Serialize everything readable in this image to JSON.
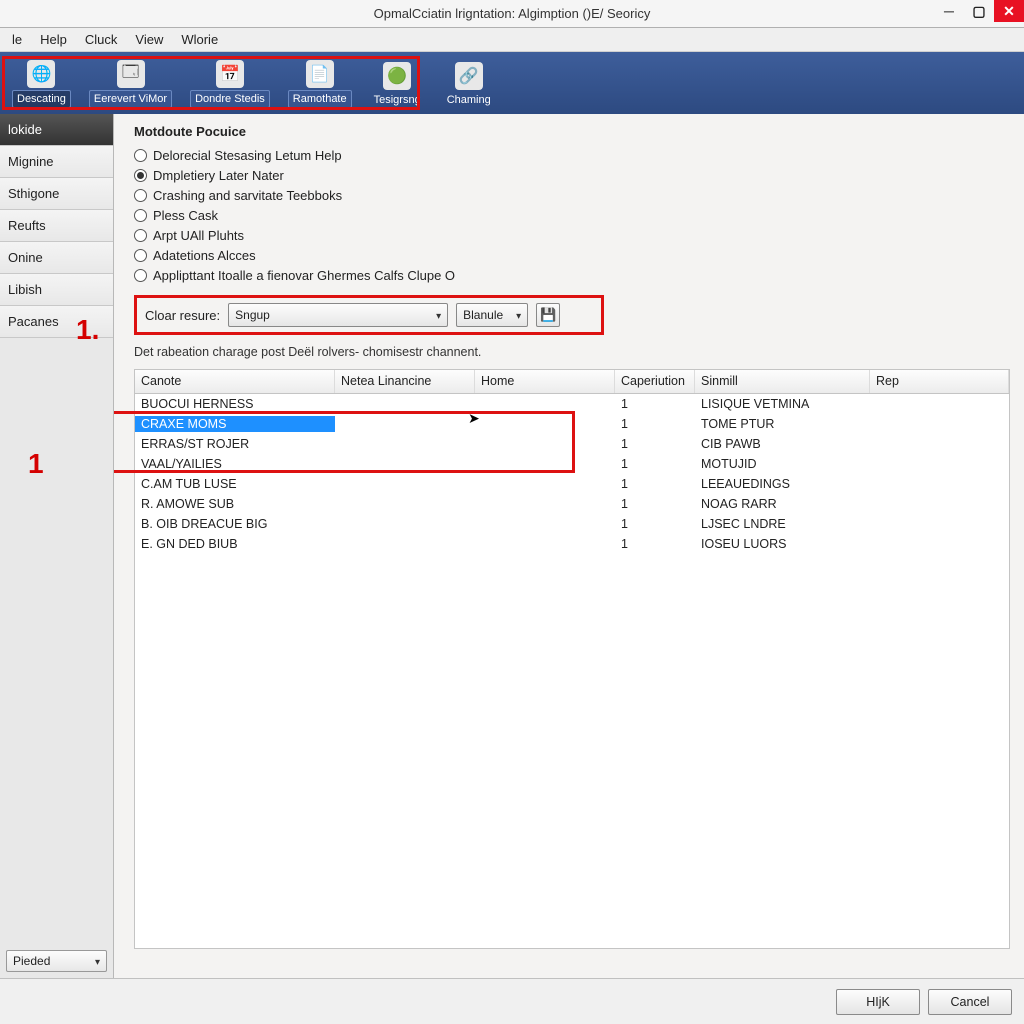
{
  "title": "OpmalCciatin lrigntation: Algimption ()E/ Seoricy",
  "menu": [
    "le",
    "Help",
    "Cluck",
    "View",
    "Wlorie"
  ],
  "toolbar": [
    {
      "id": "descating",
      "label": "Descating",
      "icon": "🌐",
      "active": true
    },
    {
      "id": "eerevert",
      "label": "Eerevert ViMor",
      "icon": "🗔",
      "boxed": true
    },
    {
      "id": "dondre",
      "label": "Dondre Stedis",
      "icon": "📅",
      "boxed": true
    },
    {
      "id": "ramothate",
      "label": "Ramothate",
      "icon": "📄",
      "boxed": true
    },
    {
      "id": "tesigrsng",
      "label": "Tesigrsng",
      "icon": "🟢"
    },
    {
      "id": "chaming",
      "label": "Chaming",
      "icon": "🔗"
    }
  ],
  "sidebar": {
    "items": [
      {
        "label": "lokide",
        "active": true
      },
      {
        "label": "Mignine"
      },
      {
        "label": "Sthigone"
      },
      {
        "label": "Reufts"
      },
      {
        "label": "Onine"
      },
      {
        "label": "Libish"
      },
      {
        "label": "Pacanes"
      }
    ],
    "bottom_select": "Pieded"
  },
  "annotations": {
    "num1_sidebar": "1.",
    "num1_table": "1"
  },
  "section_title": "Motdoute Pocuice",
  "radios": [
    {
      "label": "Delorecial Stesasing Letum Help",
      "checked": false
    },
    {
      "label": "Dmpletiery Later Nater",
      "checked": true
    },
    {
      "label": "Crashing and sarvitate Teebboks",
      "checked": false
    },
    {
      "label": "Pless Cask",
      "checked": false
    },
    {
      "label": "Arpt UAll Pluhts",
      "checked": false
    },
    {
      "label": "Adatetions Alcces",
      "checked": false
    },
    {
      "label": "Applipttant Itoalle a fienovar Ghermes Calfs Clupe O",
      "checked": false
    }
  ],
  "filter": {
    "label": "Cloar resure:",
    "select_value": "Sngup",
    "button_label": "Blanule",
    "icon": "💾"
  },
  "description": "Det rabeation charage post Deël rolvers- chomisestr channent.",
  "table": {
    "columns": [
      "Canote",
      "Netea Linancine",
      "Home",
      "Caperiution",
      "Sinmill",
      "Rep"
    ],
    "rows": [
      {
        "canote": "BUOCUI HERNESS",
        "netea": "",
        "home": "",
        "cap": "1",
        "sin": "LISIQUE VETMINA",
        "rep": ""
      },
      {
        "canote": "CRAXE MOMS",
        "netea": "",
        "home": "",
        "cap": "1",
        "sin": "TOME PTUR",
        "rep": "",
        "selected": true
      },
      {
        "canote": "ERRAS/ST ROJER",
        "netea": "",
        "home": "",
        "cap": "1",
        "sin": "CIB PAWB",
        "rep": ""
      },
      {
        "canote": "VAAL/YAILIES",
        "netea": "",
        "home": "",
        "cap": "1",
        "sin": "MOTUJID",
        "rep": ""
      },
      {
        "canote": "C.AM TUB LUSE",
        "netea": "",
        "home": "",
        "cap": "1",
        "sin": "LEEAUEDINGS",
        "rep": ""
      },
      {
        "canote": "R. AMOWE SUB",
        "netea": "",
        "home": "",
        "cap": "1",
        "sin": "NOAG RARR",
        "rep": ""
      },
      {
        "canote": "B. OIB DREACUE BIG",
        "netea": "",
        "home": "",
        "cap": "1",
        "sin": "LJSEC LNDRE",
        "rep": ""
      },
      {
        "canote": "E. GN DED BIUB",
        "netea": "",
        "home": "",
        "cap": "1",
        "sin": "IOSEU LUORS",
        "rep": ""
      }
    ]
  },
  "footer": {
    "ok": "HIjK",
    "cancel": "Cancel"
  }
}
